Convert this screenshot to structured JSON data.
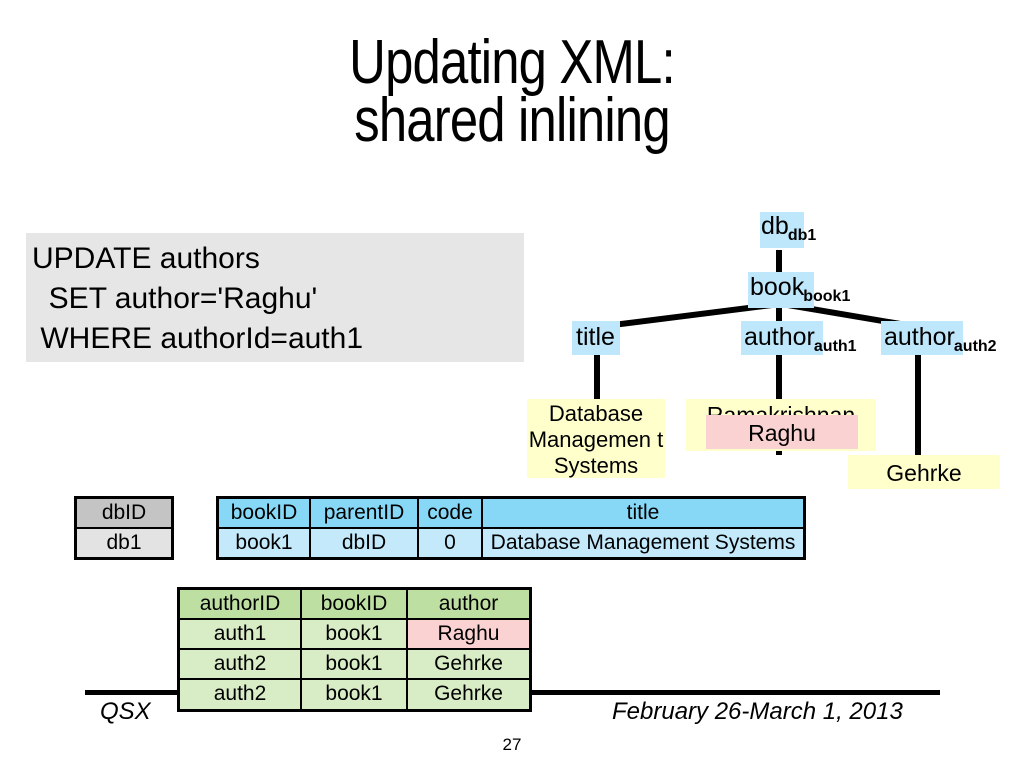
{
  "slide": {
    "title": "Updating XML:\nshared inlining",
    "page_number": "27"
  },
  "sql_box": {
    "text": "UPDATE authors\n  SET author='Raghu'\n WHERE authorId=auth1"
  },
  "tree": {
    "nodes": [
      {
        "label": "db",
        "subscript": "db1"
      },
      {
        "label": "book",
        "subscript": "book1"
      },
      {
        "label": "title",
        "subscript": ""
      },
      {
        "label": "author",
        "subscript": "auth1"
      },
      {
        "label": "author",
        "subscript": "auth2"
      }
    ],
    "leaves": [
      {
        "text": "Database Managemen t Systems",
        "color": "#ffffcc"
      },
      {
        "text": "Ramakrishnan",
        "color": "#ffffcc"
      },
      {
        "text": "Raghu",
        "color": "#fbd2d2"
      },
      {
        "text": "Gehrke",
        "color": "#ffffcc"
      }
    ]
  },
  "tables": {
    "db": {
      "headers": [
        "dbID"
      ],
      "rows": [
        [
          "db1"
        ]
      ]
    },
    "books": {
      "headers": [
        "bookID",
        "parentID",
        "code",
        "title"
      ],
      "rows": [
        [
          "book1",
          "dbID",
          "0",
          "Database Management Systems"
        ]
      ]
    },
    "authors": {
      "headers": [
        "authorID",
        "bookID",
        "author"
      ],
      "rows": [
        [
          "auth1",
          "book1",
          "Raghu"
        ],
        [
          "auth2",
          "book1",
          "Gehrke"
        ],
        [
          "auth2",
          "book1",
          "Gehrke"
        ]
      ]
    }
  },
  "footer": {
    "left": "QSX",
    "right": "February 26-March 1, 2013"
  },
  "colors": {
    "element_node": "#bfe7fb",
    "value_yellow": "#ffffcc",
    "value_pink": "#fbd2d2",
    "table_blue_head": "#87d8f7",
    "table_blue_cell": "#c3e9fb",
    "table_green_head": "#bedfa2",
    "table_green_cell": "#d8ecc5",
    "table_gray_head": "#c4c4c4",
    "sql_background": "#e6e6e6"
  }
}
